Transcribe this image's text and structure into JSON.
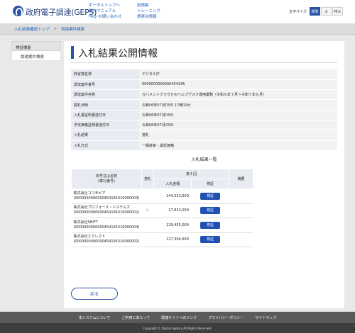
{
  "header": {
    "logo_text": "政府電子調達(GEPS)",
    "links_col1": [
      "ポータルトップへ",
      "操作マニュアル",
      "FAQ･お問い合わせ"
    ],
    "links_col2": [
      "用語集",
      "トレーニング",
      "調達合情報"
    ],
    "font_size_label": "文字サイズ",
    "font_sizes": [
      "標準",
      "大",
      "特大"
    ],
    "font_size_selected": "標準"
  },
  "breadcrumb": [
    "入札結果確認トップ",
    "調達案件検索"
  ],
  "sidebar": {
    "heading": "検証機能",
    "items": [
      "調達案件検索"
    ]
  },
  "main": {
    "title": "入札結果公開情報",
    "info_rows": [
      {
        "label": "府省等名称",
        "value": "デジタル庁"
      },
      {
        "label": "調達案件番号",
        "value": "0000000000000454195"
      },
      {
        "label": "調達案件名称",
        "value": "ガバメントクラウドのヘルプデスク運用業務（令和６年７月～令和７年６月）"
      },
      {
        "label": "開札日時",
        "value": "令和06年07月03日 17時02分"
      },
      {
        "label": "入札書証明書送付日",
        "value": "令和06年07月03日"
      },
      {
        "label": "予定価格証明書送付日",
        "value": "令和06年07月03日"
      },
      {
        "label": "入札結果",
        "value": "落札"
      },
      {
        "label": "入札方式",
        "value": "一般競争・最低価格"
      }
    ],
    "results_title": "入札結果一覧",
    "results_headers": {
      "bidder": "商号又は名称\n(専行番号)",
      "won": "落札",
      "round": "第１回",
      "amount": "入札金額",
      "verify": "検証",
      "remarks": "摘要"
    },
    "results": [
      {
        "name": "株式会社ココモビア",
        "id": "(0000000000000454195310000003)",
        "won": "",
        "amount": "144,523,600",
        "verify": "検証"
      },
      {
        "name": "株式会社プロフォース・システムズ",
        "id": "(0000000000000454195310000001)",
        "won": "○",
        "amount": "17,832,000",
        "verify": "検証"
      },
      {
        "name": "株式会社SHIFT",
        "id": "(0000000000000454195310000004)",
        "won": "",
        "amount": "129,455,000",
        "verify": "検証"
      },
      {
        "name": "株式会社エクレクト",
        "id": "(0000000000000454195310000002)",
        "won": "",
        "amount": "127,394,600",
        "verify": "検証"
      }
    ],
    "back_label": "戻る"
  },
  "footer": {
    "links": [
      "本システムについて",
      "ご利用にあたって",
      "関連サイトへのリンク",
      "プライバシーポリシー",
      "サイトマップ"
    ],
    "copyright": "Copyright © Digital Agency All Rights Reserved."
  }
}
